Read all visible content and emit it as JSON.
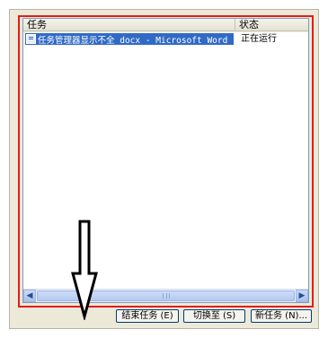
{
  "listview": {
    "columns": {
      "task": "任务",
      "status": "状态"
    },
    "rows": [
      {
        "task": "任务管理器显示不全 docx - Microsoft Word",
        "status": "正在运行",
        "selected": true
      }
    ]
  },
  "buttons": {
    "end_task": "结束任务 (E)",
    "switch_to": "切换至 (S)",
    "new_task": "新任务 (N)..."
  },
  "colors": {
    "annotation_outline": "#e41c1c",
    "selection": "#316ac5"
  },
  "annotation": {
    "arrow_icon": "down-arrow-icon"
  }
}
